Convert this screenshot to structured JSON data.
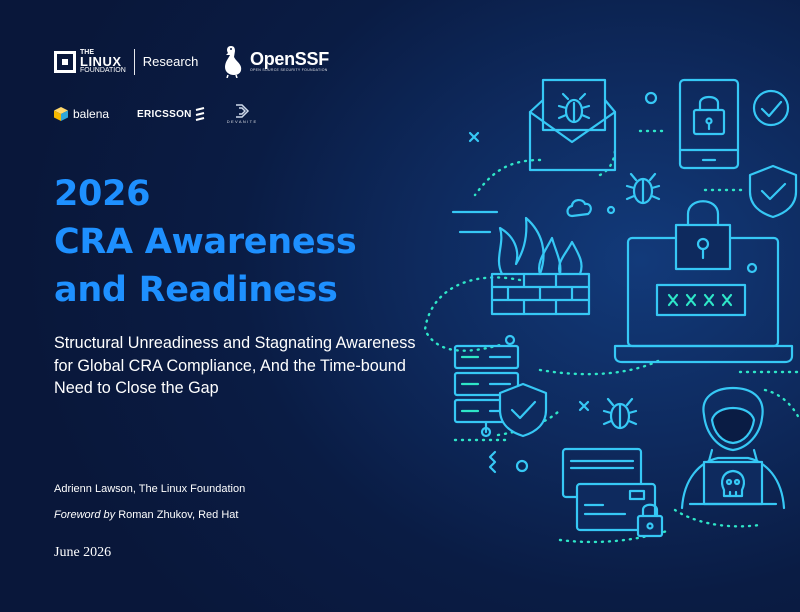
{
  "logos": {
    "linux_foundation": {
      "line1": "THE",
      "line2": "LINUX",
      "line3": "FOUNDATION",
      "unit": "Research"
    },
    "openssf": {
      "name": "OpenSSF",
      "tagline": "OPEN SOURCE SECURITY FOUNDATION"
    },
    "sponsors": {
      "balena": "balena",
      "ericsson": "ERICSSON",
      "devanite": "DEVANITE"
    }
  },
  "title": {
    "line1": "2026",
    "line2": "CRA Awareness",
    "line3": "and Readiness"
  },
  "subtitle": "Structural Unreadiness and Stagnating Awareness for Global CRA Compliance, And the Time-bound Need to Close the Gap",
  "authors": {
    "author": "Adrienn Lawson, The Linux Foundation",
    "foreword_label": "Foreword by",
    "foreword_person": "Roman Zhukov, Red Hat"
  },
  "date": "June 2026",
  "colors": {
    "title": "#1e90ff",
    "line_art": "#36c8f5",
    "accent": "#2ee6c8",
    "background": "#0a1c44"
  },
  "illustration": {
    "password_mask": "××××",
    "icons": [
      "envelope-bug-icon",
      "phone-lock-icon",
      "shield-check-icon",
      "bug-icon",
      "cloud-icon",
      "firewall-icon",
      "laptop-lock-icon",
      "server-icon",
      "credit-card-icon",
      "hacker-icon",
      "skull-icon"
    ]
  }
}
